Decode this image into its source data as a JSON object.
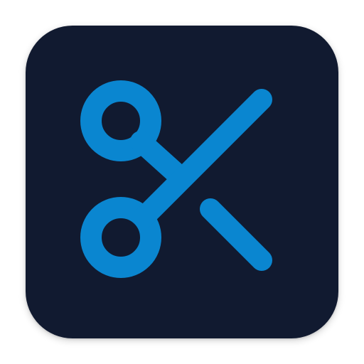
{
  "icon": {
    "symbol": "scissors-icon",
    "background_color": "#111a30",
    "glyph_color": "#0a86d0",
    "page_background": "#ffffff"
  }
}
